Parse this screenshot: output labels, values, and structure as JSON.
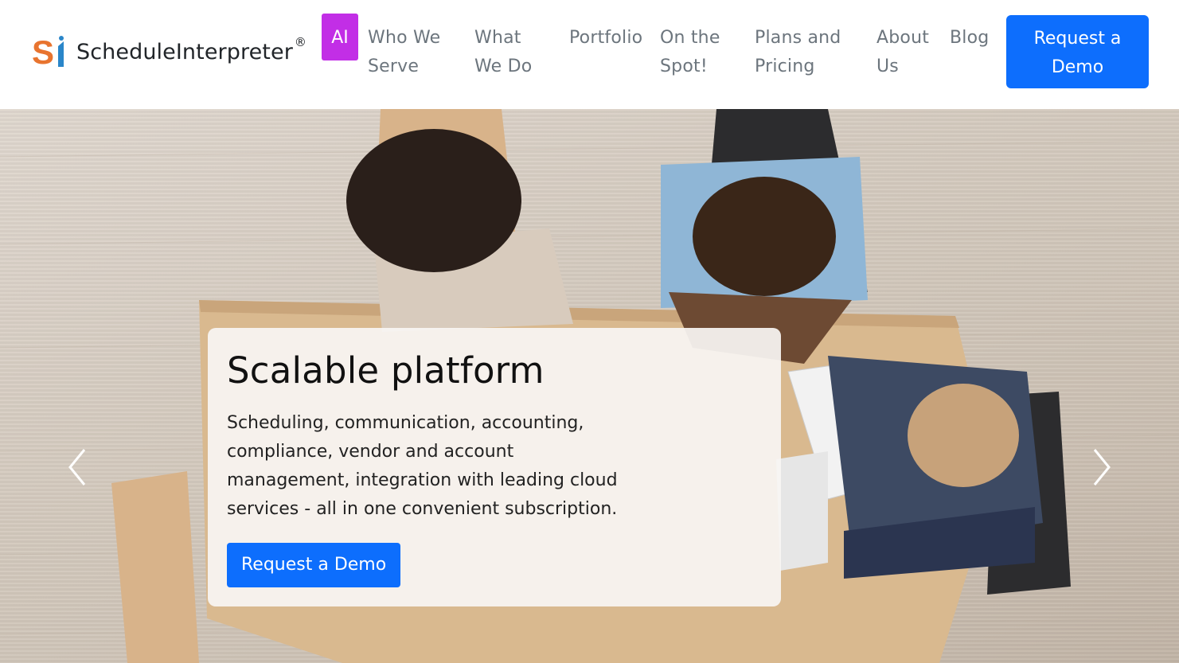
{
  "brand": {
    "name": "ScheduleInterpreter",
    "registered": "®",
    "logo_letters": "SI",
    "logo_colors": {
      "s": "#e8742f",
      "i": "#2a86c9"
    }
  },
  "nav": {
    "ai_badge": "AI",
    "items": [
      {
        "label": "Who We Serve"
      },
      {
        "label": "What We Do"
      },
      {
        "label": "Portfolio"
      },
      {
        "label": "On the Spot!"
      },
      {
        "label": "Plans and Pricing"
      },
      {
        "label": "About Us"
      },
      {
        "label": "Blog"
      }
    ],
    "cta_label": "Request a Demo"
  },
  "hero": {
    "title": "Scalable platform",
    "text": "Scheduling, communication, accounting, compliance, vendor and account management, integration with leading cloud services - all in one convenient subscription.",
    "cta_label": "Request a Demo",
    "prev_icon": "chevron-left-icon",
    "next_icon": "chevron-right-icon"
  },
  "colors": {
    "primary": "#0d6efd",
    "ai_badge": "#c22ee6",
    "nav_text": "#6c757d"
  }
}
